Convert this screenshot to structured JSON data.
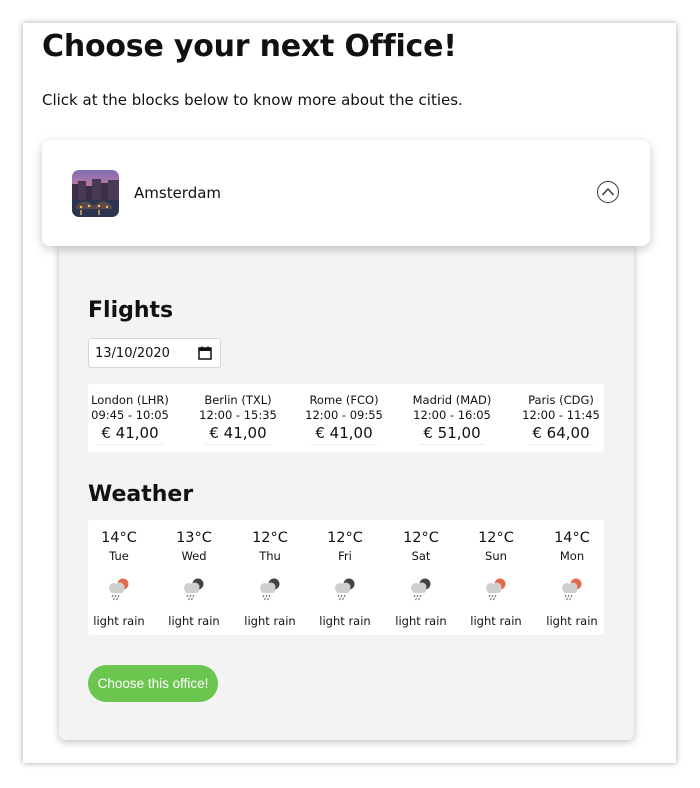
{
  "page": {
    "title": "Choose your next Office!",
    "intro": "Click at the blocks below to know more about the cities."
  },
  "city": {
    "name": "Amsterdam",
    "thumbnail_icon": "amsterdam-canal-photo",
    "expanded": true
  },
  "flights": {
    "heading": "Flights",
    "date": "13/10/2020",
    "items": [
      {
        "destination": "London (LHR)",
        "times": "09:45 - 10:05",
        "price": "€ 41,00"
      },
      {
        "destination": "Berlin (TXL)",
        "times": "12:00 - 15:35",
        "price": "€ 41,00"
      },
      {
        "destination": "Rome (FCO)",
        "times": "12:00 - 09:55",
        "price": "€ 41,00"
      },
      {
        "destination": "Madrid (MAD)",
        "times": "12:00 - 16:05",
        "price": "€ 51,00"
      },
      {
        "destination": "Paris (CDG)",
        "times": "12:00 - 11:45",
        "price": "€ 64,00"
      }
    ]
  },
  "weather": {
    "heading": "Weather",
    "days": [
      {
        "temp": "14°C",
        "day": "Tue",
        "desc": "light rain",
        "icon": "day-rain-icon"
      },
      {
        "temp": "13°C",
        "day": "Wed",
        "desc": "light rain",
        "icon": "night-rain-icon"
      },
      {
        "temp": "12°C",
        "day": "Thu",
        "desc": "light rain",
        "icon": "night-rain-icon"
      },
      {
        "temp": "12°C",
        "day": "Fri",
        "desc": "light rain",
        "icon": "night-rain-icon"
      },
      {
        "temp": "12°C",
        "day": "Sat",
        "desc": "light rain",
        "icon": "night-rain-icon"
      },
      {
        "temp": "12°C",
        "day": "Sun",
        "desc": "light rain",
        "icon": "day-rain-icon"
      },
      {
        "temp": "14°C",
        "day": "Mon",
        "desc": "light rain",
        "icon": "day-rain-icon"
      }
    ]
  },
  "actions": {
    "choose_label": "Choose this office!"
  },
  "colors": {
    "button": "#6ac64f",
    "panel": "#f3f3f3",
    "sun": "#e2694a",
    "moon": "#444444"
  }
}
